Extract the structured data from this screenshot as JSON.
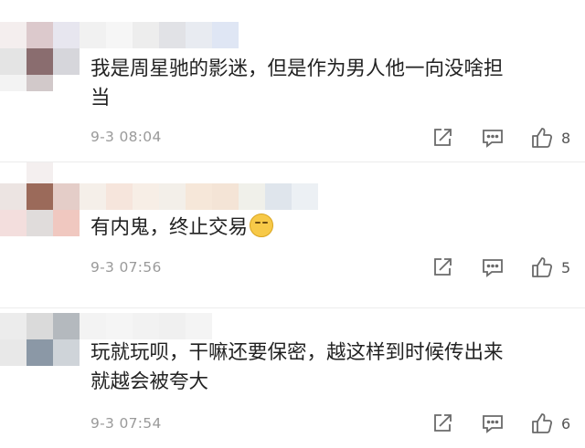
{
  "comments": [
    {
      "text_line1": "我是周星驰的影迷，但是作为男人他一向没啥担",
      "text_line2": "当",
      "time": "9-3 08:04",
      "likes": "8",
      "has_emoji": false
    },
    {
      "text_line1": "有内鬼，终止交易",
      "text_line2": "",
      "time": "9-3 07:56",
      "likes": "5",
      "has_emoji": true
    },
    {
      "text_line1": "玩就玩呗，干嘛还要保密，越这样到时候传出来",
      "text_line2": "就越会被夸大",
      "time": "9-3 07:54",
      "likes": "6",
      "has_emoji": false
    }
  ],
  "icons": {
    "repost": "repost-icon",
    "comment": "comment-icon",
    "like": "thumbs-up-icon"
  },
  "colors": {
    "text": "#222222",
    "meta": "#9a9a9a",
    "icon": "#6a6a6a"
  }
}
